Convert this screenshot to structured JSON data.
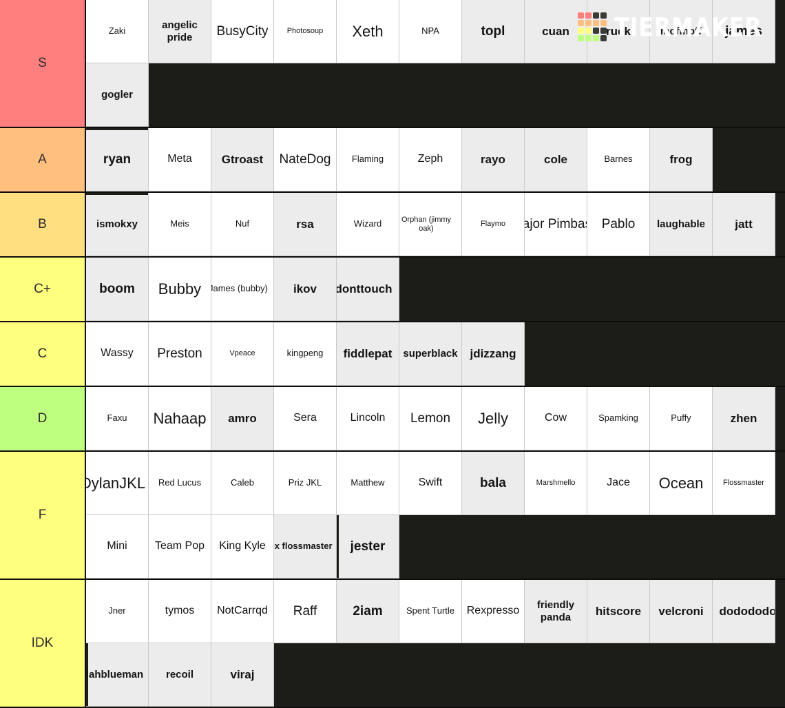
{
  "brand": {
    "name": "TIERMAKER",
    "logo_colors": {
      "s": "#ff7f7f",
      "a": "#ffbf7f",
      "b": "#ffdf7f",
      "c": "#ffff7f",
      "d": "#bfff7f",
      "empty": "#3a3a36"
    },
    "logo_grid": [
      [
        "s",
        "s",
        "empty",
        "empty"
      ],
      [
        "a",
        "a",
        "a",
        "a"
      ],
      [
        "c",
        "c",
        "empty",
        "empty"
      ],
      [
        "d",
        "d",
        "d",
        "empty"
      ]
    ]
  },
  "canvas": {
    "background": "#1c1c18",
    "cell_white": "#ffffff",
    "cell_gray": "#ececec"
  },
  "tiers": [
    {
      "label": "S",
      "color": "#ff7f7f",
      "rows": 2,
      "items": [
        {
          "label": "Zaki",
          "bg": "white",
          "style": "f-sm"
        },
        {
          "label": "angelic pride",
          "bg": "gray",
          "style": "b-md",
          "wrap": true
        },
        {
          "label": "BusyCity",
          "bg": "white",
          "style": "f-lg"
        },
        {
          "label": "Photosoup",
          "bg": "white",
          "style": "f-xs"
        },
        {
          "label": "Xeth",
          "bg": "white",
          "style": "f-xl"
        },
        {
          "label": "NPA",
          "bg": "white",
          "style": "f-sm"
        },
        {
          "label": "topl",
          "bg": "gray",
          "style": "b-xl"
        },
        {
          "label": "cuan",
          "bg": "gray",
          "style": "b-lg"
        },
        {
          "label": "ruek",
          "bg": "gray",
          "style": "b-lg"
        },
        {
          "label": "mofmoff",
          "bg": "gray",
          "style": "b-md"
        },
        {
          "label": "james",
          "bg": "gray",
          "style": "b-xl"
        },
        {
          "label": "gogler",
          "bg": "gray",
          "style": "b-md"
        }
      ]
    },
    {
      "label": "A",
      "color": "#ffbf7f",
      "rows": 1,
      "items": [
        {
          "label": "ryan",
          "bg": "gray",
          "style": "b-xl",
          "dragbottom": true
        },
        {
          "label": "Meta",
          "bg": "white",
          "style": "f-md"
        },
        {
          "label": "Gtroast",
          "bg": "gray",
          "style": "b-lg"
        },
        {
          "label": "NateDog",
          "bg": "white",
          "style": "f-lg"
        },
        {
          "label": "Flaming",
          "bg": "white",
          "style": "f-sm"
        },
        {
          "label": "Zeph",
          "bg": "white",
          "style": "f-md"
        },
        {
          "label": "rayo",
          "bg": "gray",
          "style": "b-lg"
        },
        {
          "label": "cole",
          "bg": "gray",
          "style": "b-lg"
        },
        {
          "label": "Barnes",
          "bg": "white",
          "style": "f-sm"
        },
        {
          "label": "frog",
          "bg": "gray",
          "style": "b-lg"
        }
      ]
    },
    {
      "label": "B",
      "color": "#ffdf7f",
      "rows": 1,
      "items": [
        {
          "label": "ismokxy",
          "bg": "gray",
          "style": "b-md",
          "dragtop": true
        },
        {
          "label": "Meis",
          "bg": "white",
          "style": "f-sm"
        },
        {
          "label": "Nuf",
          "bg": "white",
          "style": "f-sm"
        },
        {
          "label": "rsa",
          "bg": "gray",
          "style": "b-lg"
        },
        {
          "label": "Wizard",
          "bg": "white",
          "style": "f-sm"
        },
        {
          "label": "Orphan (jimmy oak)",
          "bg": "white",
          "style": "f-xs",
          "wrap": true,
          "clip": "left"
        },
        {
          "label": "Flaymo",
          "bg": "white",
          "style": "f-xs"
        },
        {
          "label": "Major Pimbas",
          "bg": "white",
          "style": "f-lg",
          "clip": "left"
        },
        {
          "label": "Pablo",
          "bg": "white",
          "style": "f-lg"
        },
        {
          "label": "laughable",
          "bg": "gray",
          "style": "b-md"
        },
        {
          "label": "jatt",
          "bg": "gray",
          "style": "b-lg"
        }
      ]
    },
    {
      "label": "C+",
      "color": "#ffff7f",
      "rows": 1,
      "items": [
        {
          "label": "boom",
          "bg": "gray",
          "style": "b-xl"
        },
        {
          "label": "Bubby",
          "bg": "white",
          "style": "f-xl"
        },
        {
          "label": "James (bubby)",
          "bg": "white",
          "style": "f-sm",
          "clip": "left"
        },
        {
          "label": "ikov",
          "bg": "gray",
          "style": "b-lg"
        },
        {
          "label": "donttouch",
          "bg": "gray",
          "style": "b-lg",
          "clip": "left"
        }
      ]
    },
    {
      "label": "C",
      "color": "#ffff7f",
      "rows": 1,
      "items": [
        {
          "label": "Wassy",
          "bg": "white",
          "style": "f-md"
        },
        {
          "label": "Preston",
          "bg": "white",
          "style": "f-lg"
        },
        {
          "label": "Vpeace",
          "bg": "white",
          "style": "f-xs"
        },
        {
          "label": "kingpeng",
          "bg": "white",
          "style": "f-sm"
        },
        {
          "label": "fiddlepat",
          "bg": "gray",
          "style": "b-lg"
        },
        {
          "label": "superblack",
          "bg": "gray",
          "style": "b-md"
        },
        {
          "label": "jdizzang",
          "bg": "gray",
          "style": "b-lg"
        }
      ]
    },
    {
      "label": "D",
      "color": "#bfff7f",
      "rows": 1,
      "items": [
        {
          "label": "Faxu",
          "bg": "white",
          "style": "f-sm"
        },
        {
          "label": "Nahaap",
          "bg": "white",
          "style": "f-xl"
        },
        {
          "label": "amro",
          "bg": "gray",
          "style": "b-lg"
        },
        {
          "label": "Sera",
          "bg": "white",
          "style": "f-md"
        },
        {
          "label": "Lincoln",
          "bg": "white",
          "style": "f-md"
        },
        {
          "label": "Lemon",
          "bg": "white",
          "style": "f-lg"
        },
        {
          "label": "Jelly",
          "bg": "white",
          "style": "f-xl"
        },
        {
          "label": "Cow",
          "bg": "white",
          "style": "f-md"
        },
        {
          "label": "Spamking",
          "bg": "white",
          "style": "f-sm"
        },
        {
          "label": "Puffy",
          "bg": "white",
          "style": "f-sm"
        },
        {
          "label": "zhen",
          "bg": "gray",
          "style": "b-lg"
        }
      ]
    },
    {
      "label": "F",
      "color": "#ffff7f",
      "rows": 2,
      "items": [
        {
          "label": "DylanJKL",
          "bg": "white",
          "style": "f-xl",
          "clip": "left"
        },
        {
          "label": "Red Lucus",
          "bg": "white",
          "style": "f-sm"
        },
        {
          "label": "Caleb",
          "bg": "white",
          "style": "f-sm"
        },
        {
          "label": "Priz JKL",
          "bg": "white",
          "style": "f-sm"
        },
        {
          "label": "Matthew",
          "bg": "white",
          "style": "f-sm"
        },
        {
          "label": "Swift",
          "bg": "white",
          "style": "f-md"
        },
        {
          "label": "bala",
          "bg": "gray",
          "style": "b-xl"
        },
        {
          "label": "Marshmello",
          "bg": "white",
          "style": "f-xs"
        },
        {
          "label": "Jace",
          "bg": "white",
          "style": "f-md"
        },
        {
          "label": "Ocean",
          "bg": "white",
          "style": "f-xl"
        },
        {
          "label": "Flossmaster",
          "bg": "white",
          "style": "f-xs"
        },
        {
          "label": "Mini",
          "bg": "white",
          "style": "f-md"
        },
        {
          "label": "Team Pop",
          "bg": "white",
          "style": "f-md"
        },
        {
          "label": "King Kyle",
          "bg": "white",
          "style": "f-md"
        },
        {
          "label": "ex flossmaster",
          "bg": "gray",
          "style": "b-sm",
          "clip": "left"
        },
        {
          "label": "jester",
          "bg": "gray",
          "style": "b-xl",
          "dragleft": true
        }
      ]
    },
    {
      "label": "IDK",
      "color": "#ffff7f",
      "rows": 2,
      "items": [
        {
          "label": "Jner",
          "bg": "white",
          "style": "f-sm"
        },
        {
          "label": "tymos",
          "bg": "white",
          "style": "f-md"
        },
        {
          "label": "NotCarrqd",
          "bg": "white",
          "style": "f-md"
        },
        {
          "label": "Raff",
          "bg": "white",
          "style": "f-lg"
        },
        {
          "label": "2iam",
          "bg": "gray",
          "style": "b-xl"
        },
        {
          "label": "Spent Turtle",
          "bg": "white",
          "style": "f-sm"
        },
        {
          "label": "Rexpresso",
          "bg": "white",
          "style": "f-md"
        },
        {
          "label": "friendly panda",
          "bg": "gray",
          "style": "b-md",
          "wrap": true
        },
        {
          "label": "hitscore",
          "bg": "gray",
          "style": "b-lg"
        },
        {
          "label": "velcroni",
          "bg": "gray",
          "style": "b-lg"
        },
        {
          "label": "dodododo",
          "bg": "gray",
          "style": "b-lg",
          "clip": "right"
        },
        {
          "label": "dahblueman",
          "bg": "gray",
          "style": "b-md",
          "clip": "left",
          "dragleft": true
        },
        {
          "label": "recoil",
          "bg": "gray",
          "style": "b-md"
        },
        {
          "label": "viraj",
          "bg": "gray",
          "style": "b-lg"
        }
      ]
    }
  ]
}
